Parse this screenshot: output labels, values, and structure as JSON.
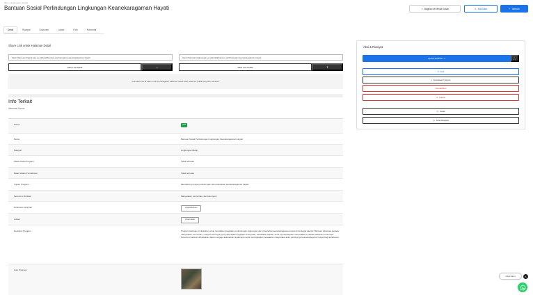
{
  "breadcrumb": "Ikan / Lingkungan / Detail",
  "page_title": "Bantuan Sosial Perlindungan Lingkungan Keanekaragaman Hayati",
  "header": {
    "btn_share": "Bagikan ke Media Sosial",
    "btn_edit": "Edit Data",
    "btn_add": "Tambah"
  },
  "tabs": [
    "Detail",
    "Riwayat",
    "Dokumen",
    "Lokasi",
    "Foto",
    "Komentar"
  ],
  "share": {
    "title": "Share Link untuk Halaman Detail",
    "link1": "https://bantuan.lingkungan.go.id/detail/bansos-perlindungan-keanekaragaman-hayati",
    "link2": "https://bantuan.lingkungan.go.id/publik/bansos-perlindungan-keanekaragaman-hayati",
    "copy1": "Salin Link Detail",
    "copy2": "Salin Link Publik",
    "note": "Gunakan link di atas untuk membagikan halaman detail atau halaman publik program bantuan."
  },
  "detail": {
    "title": "Info Terkait",
    "subtitle": "Informasi Umum",
    "rows": [
      {
        "key": "Status",
        "value": "Aktif",
        "type": "badge"
      },
      {
        "key": "Nama",
        "value": "Bantuan Sosial Perlindungan Lingkungan Keanekaragaman Hayati",
        "type": "text"
      },
      {
        "key": "Kategori",
        "value": "Lingkungan Hidup",
        "type": "text"
      },
      {
        "key": "Waktu Mulai Program",
        "value": "Tidak terbatas",
        "type": "text"
      },
      {
        "key": "Batas Waktu Pendaftaran",
        "value": "Tidak terbatas",
        "type": "text"
      },
      {
        "key": "Tujuan Program",
        "value": "Mendukung upaya perlindungan dan pelestarian keanekaragaman hayati",
        "type": "text"
      },
      {
        "key": "Penerima Manfaat",
        "value": "Masyarakat, komunitas, dan kelompok",
        "type": "text"
      },
      {
        "key": "Dokumen Lampiran",
        "value": "Lihat Dokumen",
        "type": "button"
      },
      {
        "key": "Lokasi",
        "value": "Lihat Lokasi",
        "type": "button"
      },
      {
        "key": "Deskripsi Program",
        "value": "Program bantuan ini ditujukan untuk mendukung kegiatan perlindungan lingkungan dan pelestarian keanekaragaman hayati di berbagai daerah. Bantuan diberikan kepada masyarakat, komunitas, maupun kelompok yang aktif dalam kegiatan konservasi, rehabilitasi habitat, serta pemberdayaan masyarakat di sekitar kawasan konservasi. Penerima bantuan diharapkan dapat menjaga kelestarian lingkungan serta meningkatkan kesadaran masyarakat akan pentingnya keanekaragaman hayati bagi kehidupan.",
        "type": "long"
      },
      {
        "key": "Foto Program",
        "value": "",
        "type": "image"
      }
    ]
  },
  "side": {
    "title": "Aksi & Riwayat",
    "primary": "Ajukan Bantuan",
    "expand_symbol": "⛶",
    "btn_edit": "Edit",
    "btn_export": "Download / Export",
    "btn_disable": "Nonaktifkan",
    "btn_delete": "Hapus",
    "btn_print": "Cetak",
    "btn_history": "Lihat Riwayat"
  },
  "chat": {
    "label": "Chat Kami",
    "close": "×"
  }
}
